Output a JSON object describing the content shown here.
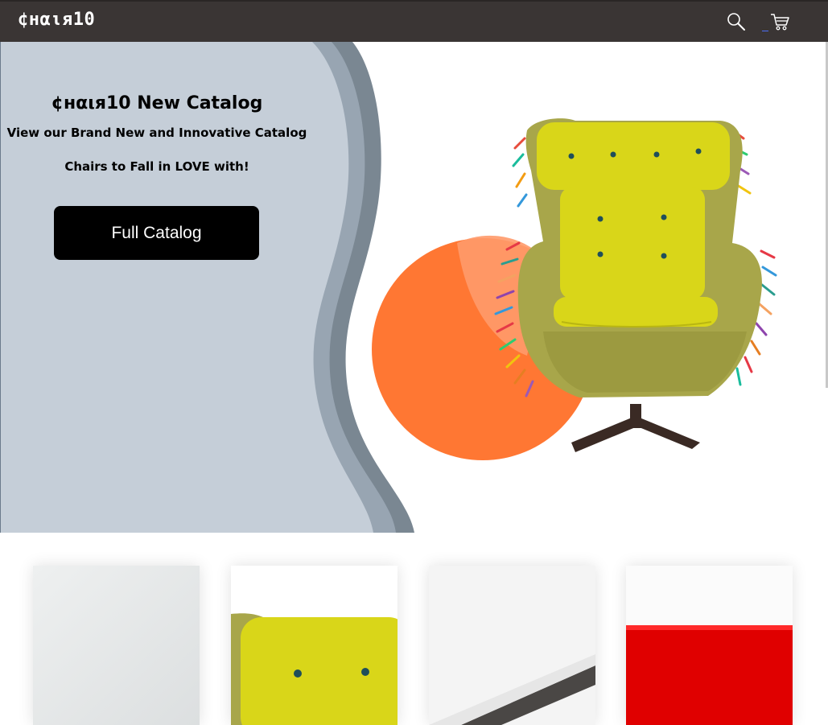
{
  "nav": {
    "brand": "¢нαιя10",
    "search_icon": "search-icon",
    "cart_icon": "cart-icon"
  },
  "hero": {
    "title": "¢нαιя10 New Catalog",
    "subtitle": "View our Brand New and Innovative Catalog",
    "tagline": "Chairs to Fall in LOVE with!",
    "button_label": "Full Catalog"
  },
  "colors": {
    "navbar": "#3a3534",
    "hero_panel": "#c5ced8",
    "wave_mid": "#98a5b2",
    "wave_dark": "#7a8792",
    "accent_orange": "#ff7733",
    "chair_yellow": "#d9d619",
    "chair_body": "#a8a64a"
  },
  "cards": [
    {
      "name": "product-card-1",
      "image": "white-chair-image"
    },
    {
      "name": "product-card-2",
      "image": "yellow-cushion-image"
    },
    {
      "name": "product-card-3",
      "image": "white-panel-image"
    },
    {
      "name": "product-card-4",
      "image": "red-chair-image"
    }
  ]
}
